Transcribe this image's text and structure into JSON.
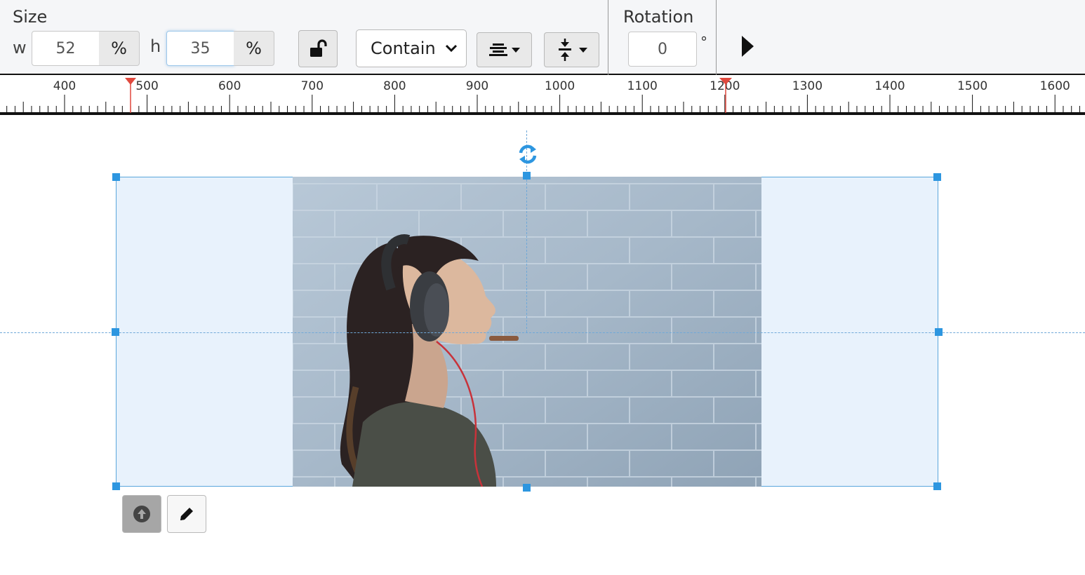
{
  "toolbar": {
    "size_label": "Size",
    "width_label": "w",
    "width_value": "52",
    "width_unit": "%",
    "height_label": "h",
    "height_value": "35",
    "height_unit": "%",
    "fit_mode": "Contain",
    "rotation_label": "Rotation",
    "rotation_value": "0",
    "rotation_unit": "°"
  },
  "ruler": {
    "ticks": [
      "400",
      "500",
      "600",
      "700",
      "800",
      "900",
      "1000",
      "1100",
      "1200",
      "1300",
      "1400",
      "1500",
      "1600"
    ]
  },
  "icons": {
    "lock": "unlock-icon",
    "h_align": "align-center-icon",
    "v_align": "vertical-center-icon",
    "play": "play-icon",
    "rotate": "rotate-icon",
    "upload": "upload-icon",
    "edit": "pencil-icon"
  },
  "colors": {
    "accent": "#2d96e0",
    "ruler_marker": "#e0493e",
    "selection_fill": "#e8f2fc"
  }
}
